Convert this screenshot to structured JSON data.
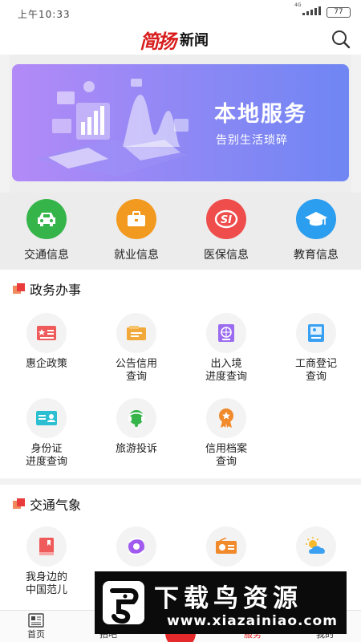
{
  "status_bar": {
    "time": "上午10:33",
    "network": "4G",
    "battery": "77"
  },
  "header": {
    "logo_script": "简扬",
    "logo_text": "新闻",
    "search_icon": "search-icon"
  },
  "banner": {
    "title": "本地服务",
    "subtitle": "告别生活琐碎",
    "colors": [
      "#b38af7",
      "#6f86f3"
    ]
  },
  "quick_services": [
    {
      "label": "交通信息",
      "icon": "car-icon",
      "color": "#35b44a"
    },
    {
      "label": "就业信息",
      "icon": "briefcase-icon",
      "color": "#f29a1f"
    },
    {
      "label": "医保信息",
      "icon": "social-insurance-icon",
      "color": "#ef4c4c"
    },
    {
      "label": "教育信息",
      "icon": "graduation-cap-icon",
      "color": "#2b9ef0"
    }
  ],
  "government": {
    "title": "政务办事",
    "items": [
      {
        "label1": "惠企政策",
        "label2": "",
        "icon": "policy-card-icon",
        "color": "#ef5a5a"
      },
      {
        "label1": "公告信用",
        "label2": "查询",
        "icon": "notice-wallet-icon",
        "color": "#f2a93b"
      },
      {
        "label1": "出入境",
        "label2": "进度查询",
        "icon": "passport-icon",
        "color": "#9c6cf0"
      },
      {
        "label1": "工商登记",
        "label2": "查询",
        "icon": "business-registration-icon",
        "color": "#3aa0f2"
      },
      {
        "label1": "身份证",
        "label2": "进度查询",
        "icon": "id-card-icon",
        "color": "#2bbfd1"
      },
      {
        "label1": "旅游投诉",
        "label2": "",
        "icon": "customer-service-icon",
        "color": "#35b44a"
      },
      {
        "label1": "信用档案",
        "label2": "查询",
        "icon": "credit-badge-icon",
        "color": "#f08a2a"
      }
    ]
  },
  "traffic": {
    "title": "交通气象",
    "items": [
      {
        "label1": "我身边的",
        "label2": "中国范儿",
        "icon": "book-icon",
        "color": "#ef5a5a"
      },
      {
        "icon": "typhoon-icon",
        "color": "#a05af0"
      },
      {
        "icon": "radio-icon",
        "color": "#f08a2a"
      },
      {
        "icon": "weather-icon",
        "color": "#3aa0f2"
      }
    ]
  },
  "tabs": [
    {
      "label": "首页",
      "icon": "home-newspaper-icon"
    },
    {
      "label": "拍吧",
      "icon": "camera-icon"
    },
    {
      "label": "服务",
      "icon": "service-icon"
    },
    {
      "label": "我的",
      "icon": "profile-icon"
    }
  ],
  "watermark": {
    "title": "下载鸟资源",
    "url": "www.xiazainiao.com"
  }
}
